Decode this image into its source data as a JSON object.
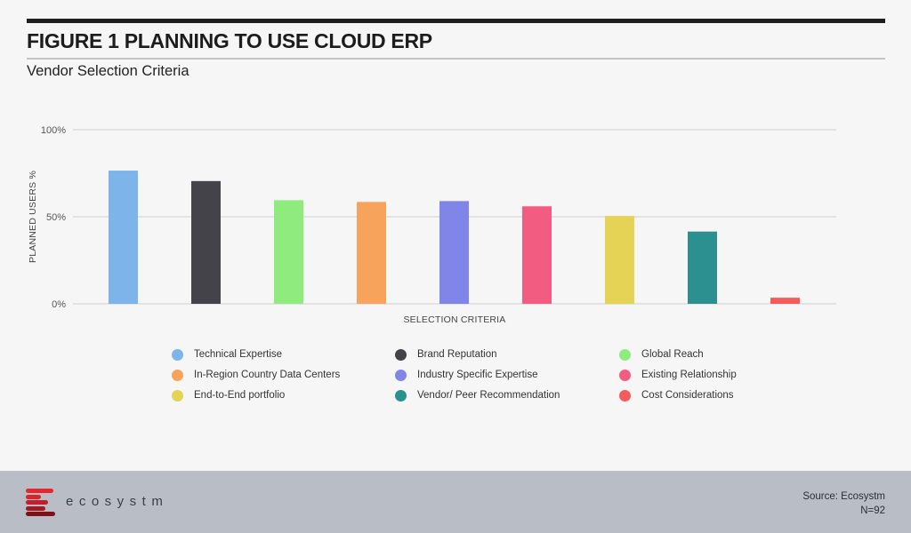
{
  "header": {
    "title": "FIGURE 1 PLANNING TO USE CLOUD ERP",
    "subtitle": "Vendor Selection Criteria"
  },
  "chart_data": {
    "type": "bar",
    "title": "Vendor Selection Criteria",
    "xlabel": "SELECTION CRITERIA",
    "ylabel": "PLANNED USERS %",
    "ylim": [
      0,
      100
    ],
    "yticks": [
      {
        "value": 0,
        "label": "0%"
      },
      {
        "value": 50,
        "label": "50%"
      },
      {
        "value": 100,
        "label": "100%"
      }
    ],
    "grid": true,
    "legend_position": "bottom",
    "categories": [
      "Technical Expertise",
      "Brand Reputation",
      "Global Reach",
      "In-Region Country Data Centers",
      "Industry Specific Expertise",
      "Existing Relationship",
      "End-to-End portfolio",
      "Vendor/ Peer Recommendation",
      "Cost Considerations"
    ],
    "values": [
      76.5,
      70.5,
      59.5,
      58.5,
      59,
      56,
      50.5,
      41.5,
      3.5
    ],
    "colors": [
      "#7db4ea",
      "#434349",
      "#90eb7e",
      "#f7a35c",
      "#8085e8",
      "#f15c80",
      "#e4d354",
      "#2b908f",
      "#f45b5b"
    ]
  },
  "legend": {
    "order": [
      0,
      1,
      2,
      3,
      4,
      5,
      6,
      7,
      8
    ]
  },
  "footer": {
    "brand": "ecosystm",
    "source": "Source: Ecosystm",
    "sample": "N=92",
    "logo_colors": [
      "#e8262b",
      "#d9242a",
      "#c41f27",
      "#a71a22",
      "#7e1219"
    ]
  }
}
